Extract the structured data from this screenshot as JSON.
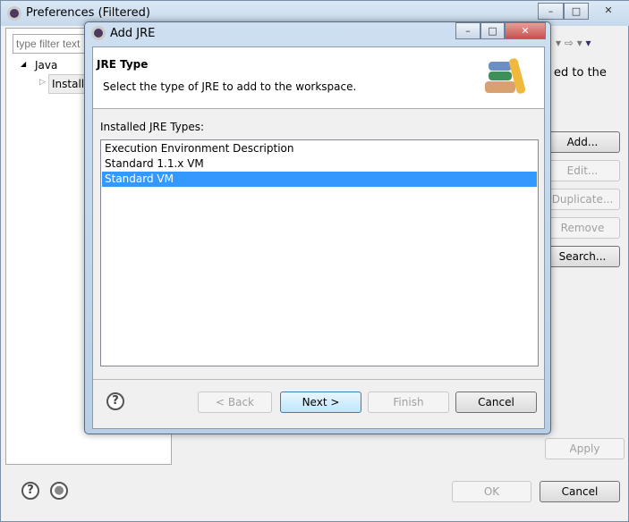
{
  "main_window": {
    "title": "Preferences (Filtered)",
    "filter_placeholder": "type filter text",
    "tree": {
      "root": "Java",
      "child": "Installed JREs"
    },
    "description_fragment": "ed to the",
    "buttons": {
      "add": "Add...",
      "edit": "Edit...",
      "duplicate": "Duplicate...",
      "remove": "Remove",
      "search": "Search...",
      "apply": "Apply",
      "ok": "OK",
      "cancel": "Cancel"
    }
  },
  "dialog": {
    "title": "Add JRE",
    "header_title": "JRE Type",
    "header_desc": "Select the type of JRE to add to the workspace.",
    "list_label": "Installed JRE Types:",
    "items": [
      "Execution Environment Description",
      "Standard 1.1.x VM",
      "Standard VM"
    ],
    "selected_index": 2,
    "buttons": {
      "back": "< Back",
      "next": "Next >",
      "finish": "Finish",
      "cancel": "Cancel"
    }
  },
  "colors": {
    "selection": "#3399ff",
    "close_button": "#c75050"
  }
}
